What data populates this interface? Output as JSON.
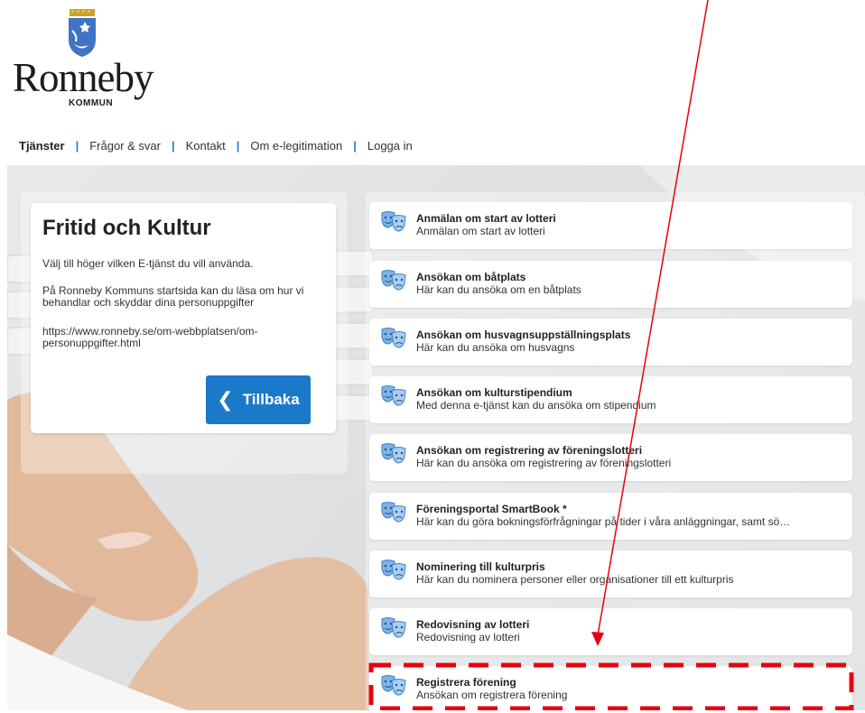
{
  "logo": {
    "name": "Ronneby",
    "sub": "KOMMUN"
  },
  "nav": {
    "items": [
      "Tjänster",
      "Frågor & svar",
      "Kontakt",
      "Om e-legitimation",
      "Logga in"
    ],
    "separator": "|",
    "active": "Tjänster"
  },
  "info": {
    "title": "Fritid och Kultur",
    "p1": "Välj till höger vilken E-tjänst du vill använda.",
    "p2": "På Ronneby Kommuns startsida kan du läsa om hur vi behandlar och skyddar dina personuppgifter",
    "p3": "https://www.ronneby.se/om-webbplatsen/om-personuppgifter.html",
    "back_label": "Tillbaka",
    "back_icon": "chevron-left-icon"
  },
  "services": [
    {
      "title": "Anmälan om start av lotteri",
      "desc": "Anmälan om start av lotteri",
      "icon": "theater-masks-icon"
    },
    {
      "title": "Ansökan om båtplats",
      "desc": "Här kan du ansöka om en båtplats",
      "icon": "theater-masks-icon"
    },
    {
      "title": "Ansökan om husvagnsuppställningsplats",
      "desc": "Här kan du ansöka om husvagns",
      "icon": "theater-masks-icon"
    },
    {
      "title": "Ansökan om kulturstipendium",
      "desc": "Med denna e-tjänst kan du ansöka om stipendium",
      "icon": "theater-masks-icon"
    },
    {
      "title": "Ansökan om registrering av föreningslotteri",
      "desc": "Här kan du ansöka om registrering av föreningslotteri",
      "icon": "theater-masks-icon"
    },
    {
      "title": "Föreningsportal SmartBook *",
      "desc": "Här kan du göra bokningsförfrågningar på tider i våra anläggningar, samt sö…",
      "icon": "theater-masks-icon"
    },
    {
      "title": "Nominering till kulturpris",
      "desc": "Här kan du nominera personer eller organisationer till ett kulturpris",
      "icon": "theater-masks-icon"
    },
    {
      "title": "Redovisning av lotteri",
      "desc": "Redovisning av lotteri",
      "icon": "theater-masks-icon"
    },
    {
      "title": "Registrera förening",
      "desc": "Ansökan om registrera förening",
      "icon": "theater-masks-icon"
    }
  ],
  "annotation": {
    "color": "#e8000e",
    "highlighted": "Registrera förening"
  },
  "colors": {
    "accent": "#1a79c8",
    "nav_separator": "#2c7ac6",
    "icon_blue": "#5b9bd5"
  }
}
